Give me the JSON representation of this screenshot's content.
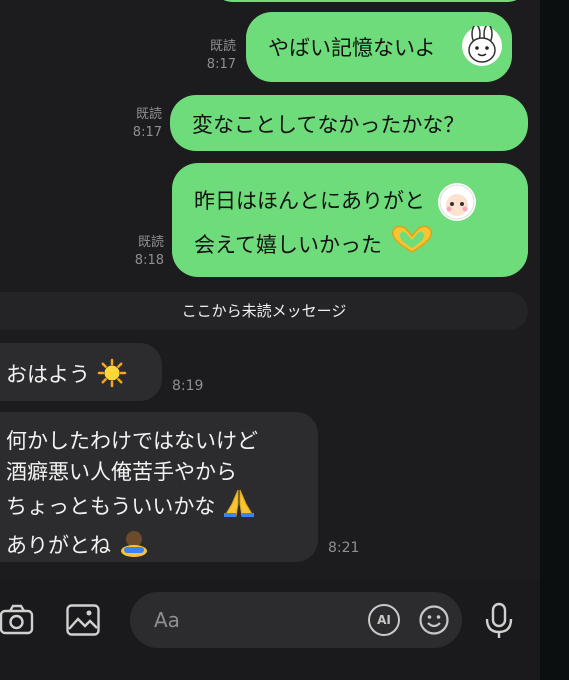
{
  "messages_out": [
    {
      "read": "既読",
      "time": "8:17",
      "text": "やばい記憶ないよ"
    },
    {
      "read": "既読",
      "time": "8:17",
      "text": "変なことしてなかったかな？"
    },
    {
      "read": "既読",
      "time": "8:18",
      "line1": "昨日はほんとにありがと",
      "line2": "会えて嬉しいかった"
    }
  ],
  "unread_divider": "ここから未読メッセージ",
  "messages_in": [
    {
      "text": "おはよう",
      "time": "8:19"
    },
    {
      "lines": [
        "何かしたわけではないけど",
        "酒癖悪い人俺苦手やから",
        "ちょっともういいかな",
        "ありがとね"
      ],
      "time": "8:21"
    }
  ],
  "composer": {
    "placeholder": "Aa",
    "ai_label": "AI"
  },
  "colors": {
    "outgoing_bubble": "#6fdc7b",
    "incoming_bubble": "#2c2c2e",
    "background": "#1c1c1e"
  },
  "icons": [
    "camera-icon",
    "image-icon",
    "ai-icon",
    "emoji-icon",
    "microphone-icon",
    "sun-emoji",
    "heart-hands-emoji",
    "pray-emoji",
    "bowing-emoji"
  ]
}
